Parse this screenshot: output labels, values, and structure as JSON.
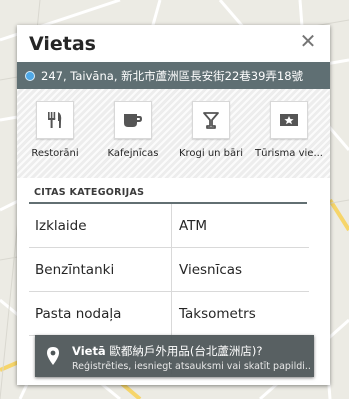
{
  "dialog": {
    "title": "Vietas",
    "close_icon": "close-icon",
    "location": "247, Taivāna, 新北市蘆洲區長安街22巷39弄18號"
  },
  "categories": [
    {
      "label": "Restorāni",
      "icon": "fork-knife-icon"
    },
    {
      "label": "Kafejnīcas",
      "icon": "coffee-cup-icon"
    },
    {
      "label": "Krogi un bāri",
      "icon": "cocktail-glass-icon"
    },
    {
      "label": "Tūrisma vie...",
      "icon": "star-ticket-icon"
    }
  ],
  "other_categories": {
    "title": "CITAS KATEGORIJAS",
    "items": [
      "Izklaide",
      "ATM",
      "Benzīntanki",
      "Viesnīcas",
      "Pasta nodaļa",
      "Taksometrs"
    ]
  },
  "info_bar": {
    "prefix": "Vietā",
    "place": "歐都納戶外用品(台北蘆洲店)?",
    "subtitle": "Reģistrēties, iesniegt atsauksmi vai skatīt papildi..."
  },
  "colors": {
    "location_bar": "#5f6f73",
    "info_bar": "#4e5658",
    "map_background": "#ecebe4"
  }
}
